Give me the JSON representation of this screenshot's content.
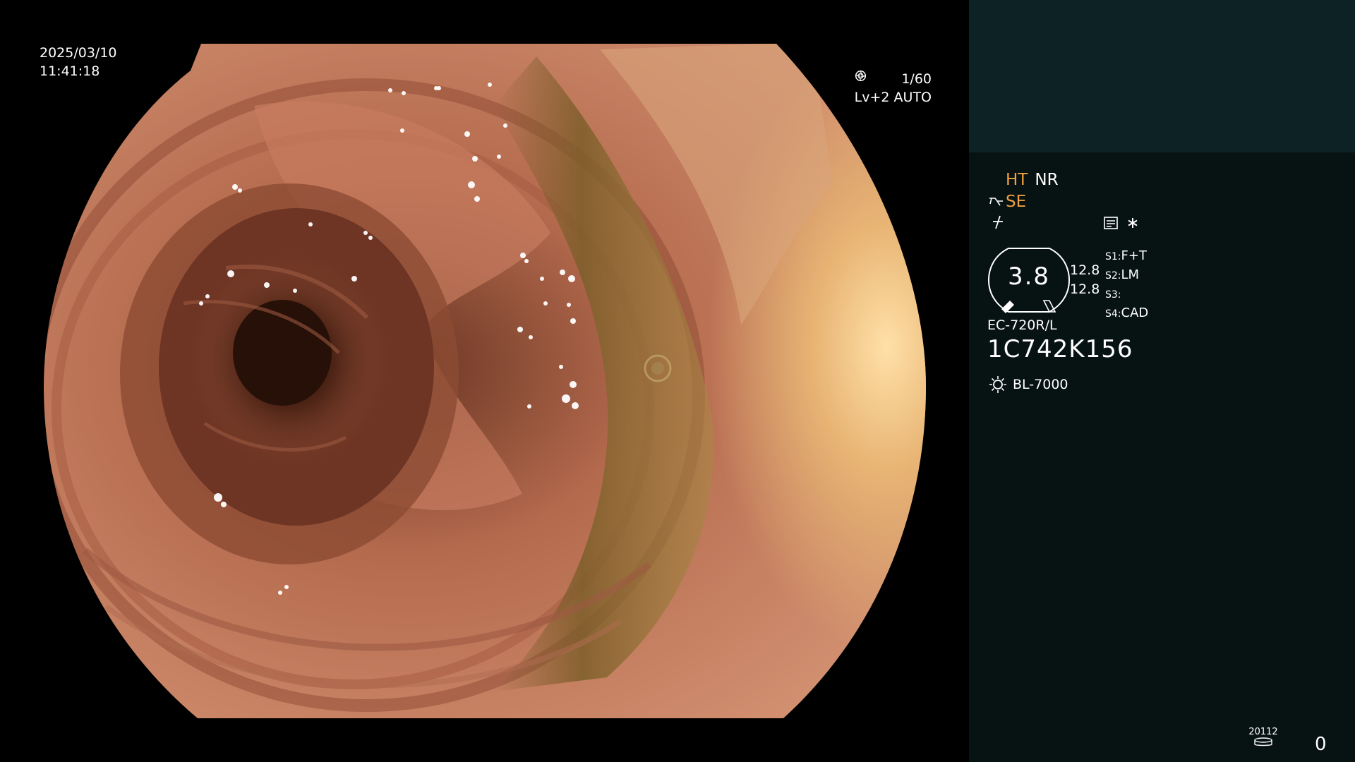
{
  "overlay": {
    "date": "2025/03/10",
    "time": "11:41:18",
    "shutter": "1/60",
    "iris": "Lv+2 AUTO"
  },
  "panel": {
    "mode_ht": "HT",
    "mode_nr": "NR",
    "mode_se": "SE",
    "zoom_value": "3.8",
    "gauge_top": "12.8",
    "gauge_bottom": "12.8",
    "switches": [
      {
        "key": "S1:",
        "value": "F+T"
      },
      {
        "key": "S2:",
        "value": "LM"
      },
      {
        "key": "S3:",
        "value": ""
      },
      {
        "key": "S4:",
        "value": "CAD"
      }
    ],
    "scope_model": "EC-720R/L",
    "serial": "1C742K156",
    "light_source": "BL-7000",
    "storage_label": "20112",
    "counter": "0"
  },
  "colors": {
    "panel_bg": "#071212",
    "panel_header_bg": "#0c2224",
    "accent_orange": "#f0a040",
    "mucosa": "#c07a5c"
  },
  "icons": [
    "shutter-icon",
    "iris-icon",
    "scope-tip-icon",
    "flash-icon",
    "memo-icon",
    "light-source-icon",
    "storage-icon"
  ]
}
